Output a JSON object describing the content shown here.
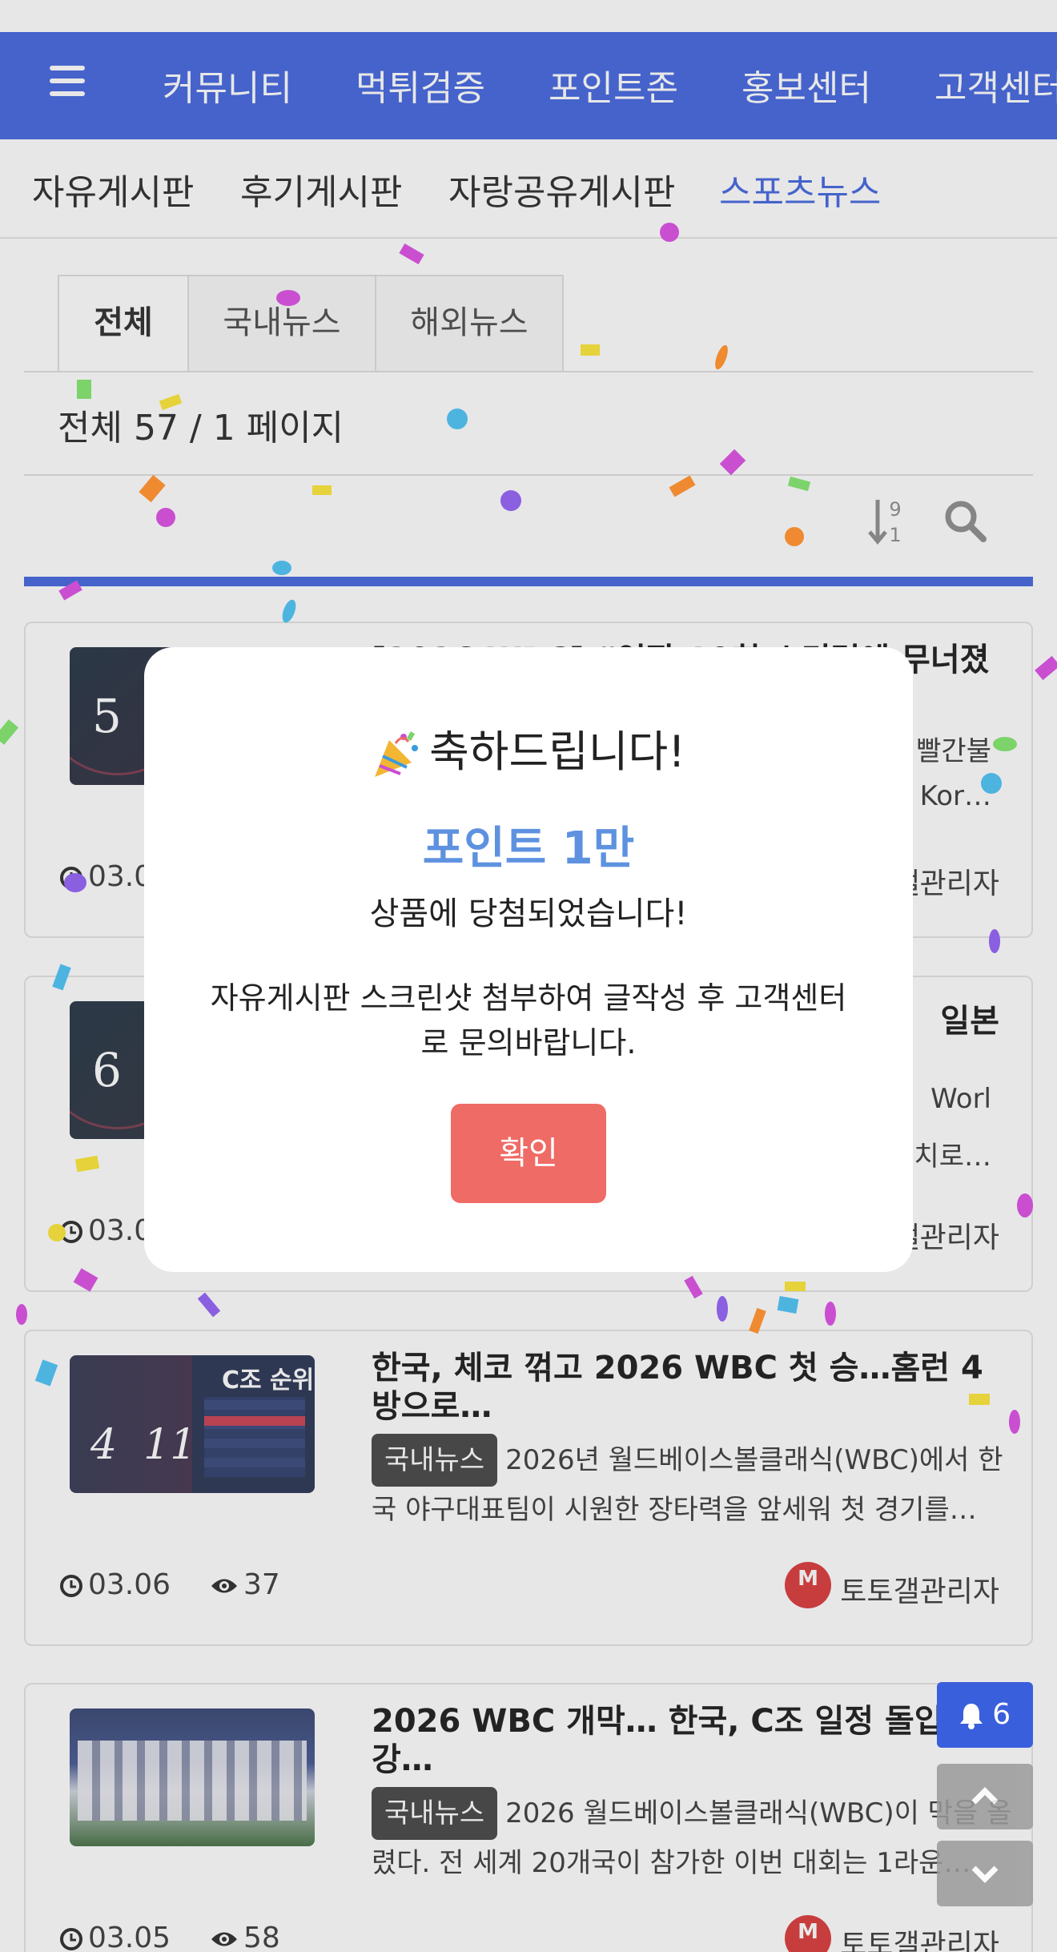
{
  "topnav": {
    "items": [
      "커뮤니티",
      "먹튀검증",
      "포인트존",
      "홍보센터",
      "고객센터"
    ]
  },
  "subnav": {
    "items": [
      "자유게시판",
      "후기게시판",
      "자랑공유게시판",
      "스포츠뉴스"
    ],
    "active": "스포츠뉴스"
  },
  "tabs": [
    "전체",
    "국내뉴스",
    "해외뉴스"
  ],
  "total_text": "전체 57 / 1 페이지",
  "sort_icon_digits": [
    "9",
    "1"
  ],
  "posts": [
    {
      "title": "[2026 WBC] “연장 10회 스리ر조에 무너졌",
      "title_visible": "[2026 WBC] “연장 10회 스리런에 무너졌",
      "summary_tail_1": "빨간불",
      "summary_tail_2": "Kor…",
      "date": "03.0",
      "author_tail": "갤관리자",
      "thumb_number": "5"
    },
    {
      "title_tail": "일본",
      "summary_tail_1": "Worl",
      "summary_tail_2": "처치로…",
      "date": "03.0",
      "author_tail": "갤관리자",
      "thumb_number": "6"
    },
    {
      "title": "한국, 체코 꺾고 2026 WBC 첫 승…홈런 4방으로…",
      "category": "국내뉴스",
      "summary": "2026년 월드베이스볼클래식(WBC)에서 한국 야구대표팀이 시원한 장타력을 앞세워 첫 경기를…",
      "date": "03.06",
      "views": "37",
      "author": "토토갤관리자",
      "thumb_left": "4  11",
      "thumb_right": "C조 순위"
    },
    {
      "title": "2026 WBC 개막… 한국, C조 일정 돌입해 8강…",
      "category": "국내뉴스",
      "summary": "2026 월드베이스볼클래식(WBC)이 막을 올렸다. 전 세계 20개국이 참가한 이번 대회는 1라운…",
      "date": "03.05",
      "views": "58",
      "author": "토토갤관리자"
    }
  ],
  "float": {
    "bell_count": "6"
  },
  "modal": {
    "title": "축하드립니다!",
    "prize": "포인트 1만",
    "message1": "상품에 당첨되었습니다!",
    "message2": "자유게시판 스크린샷 첨부하여 글작성 후 고객센터로 문의바랍니다.",
    "ok_label": "확인"
  },
  "colors": {
    "brand_blue": "#3a5fdc",
    "prize_blue": "#5e92e0",
    "ok_red": "#ef6b66"
  }
}
